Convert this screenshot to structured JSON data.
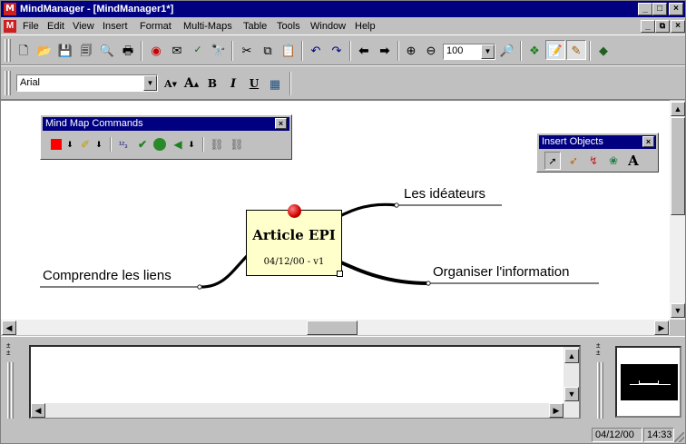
{
  "window": {
    "title": "MindManager - [MindManager1*]",
    "caption_buttons": [
      "_",
      "□",
      "×"
    ],
    "doc_buttons": [
      "_",
      "⧉",
      "×"
    ]
  },
  "menu": [
    "File",
    "Edit",
    "View",
    "Insert",
    "Format",
    "Multi-Maps",
    "Table",
    "Tools",
    "Window",
    "Help"
  ],
  "toolbar": {
    "zoom_value": "100",
    "icons": [
      "new-icon",
      "open-icon",
      "save-icon",
      "save-all-icon",
      "print-preview-icon",
      "print-icon",
      "web-icon",
      "email-icon",
      "spellcheck-icon",
      "find-icon",
      "cut-icon",
      "copy-icon",
      "paste-icon",
      "undo-icon",
      "redo-icon",
      "back-icon",
      "forward-icon",
      "zoom-in-icon",
      "zoom-out-icon",
      "zoom-combo",
      "zoom-fit-icon",
      "mindmap-tools-icon",
      "notes-icon",
      "drawing-icon",
      "help-icon"
    ]
  },
  "format_bar": {
    "font": "Arial",
    "buttons": [
      "A▲",
      "A▲",
      "B",
      "I",
      "U"
    ]
  },
  "palette_commands": {
    "title": "Mind Map Commands"
  },
  "palette_insert": {
    "title": "Insert Objects"
  },
  "map": {
    "center_title": "Article EPI",
    "center_subtitle": "04/12/00 - v1",
    "branches": {
      "top_right": "Les idéateurs",
      "right": "Organiser l'information",
      "left": "Comprendre les liens"
    }
  },
  "status": {
    "date": "04/12/00",
    "time": "14:33"
  },
  "colors": {
    "titlebar": "#000080",
    "face": "#c0c0c0",
    "topic_fill": "#ffffcc",
    "pin": "#cc0000"
  }
}
